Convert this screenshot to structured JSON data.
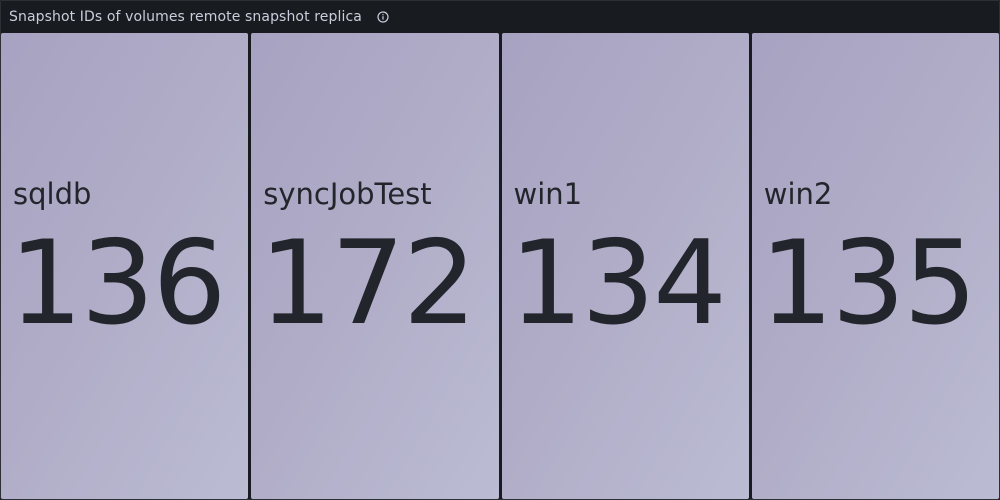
{
  "panel": {
    "title": "Snapshot IDs of volumes remote snapshot replica",
    "info_icon": "info-circle-icon"
  },
  "colors": {
    "panel_background": "#181b1f",
    "title_text": "#ccccdc",
    "tile_gradient_start": "#a7a2c1",
    "tile_gradient_end": "#bbbcd3",
    "tile_text": "#22252b"
  },
  "stats": [
    {
      "name": "sqldb",
      "value": "136"
    },
    {
      "name": "syncJobTest",
      "value": "172"
    },
    {
      "name": "win1",
      "value": "134"
    },
    {
      "name": "win2",
      "value": "135"
    }
  ]
}
